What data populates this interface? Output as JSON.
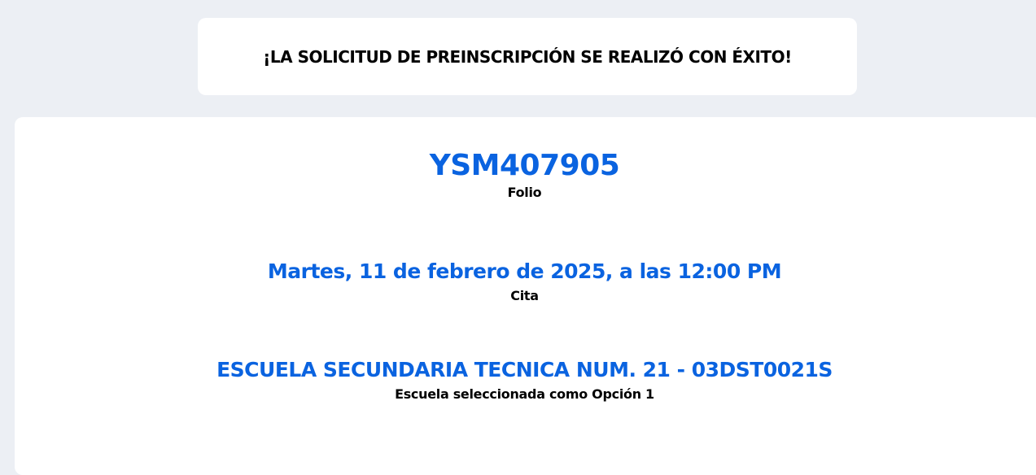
{
  "banner": {
    "message": "¡LA SOLICITUD DE PREINSCRIPCIÓN SE REALIZÓ CON ÉXITO!"
  },
  "result": {
    "folio": {
      "value": "YSM407905",
      "label": "Folio"
    },
    "cita": {
      "value": "Martes, 11 de febrero de 2025, a las 12:00 PM",
      "label": "Cita"
    },
    "escuela": {
      "value": "ESCUELA SECUNDARIA TECNICA NUM. 21 - 03DST0021S",
      "label": "Escuela seleccionada como Opción 1"
    }
  },
  "colors": {
    "background": "#eceff4",
    "card": "#ffffff",
    "accent": "#0a63e0",
    "text": "#000000"
  }
}
